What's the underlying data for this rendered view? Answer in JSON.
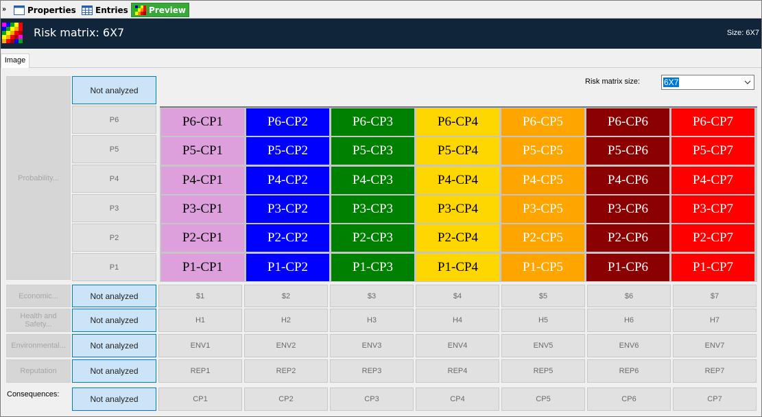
{
  "tabs": {
    "properties": "Properties",
    "entries": "Entries",
    "preview": "Preview"
  },
  "header": {
    "title": "Risk matrix: 6X7",
    "size": "Size: 6X7"
  },
  "subtab": "Image",
  "size_selector": {
    "label": "Risk matrix size:",
    "value": "6X7"
  },
  "not_analyzed": "Not analyzed",
  "probability_label": "Probability...",
  "probability_levels": [
    "P6",
    "P5",
    "P4",
    "P3",
    "P2",
    "P1"
  ],
  "column_colors": [
    "#dea0dd",
    "#0000ff",
    "#008000",
    "#ffd700",
    "#ffa500",
    "#8b0000",
    "#ff0000"
  ],
  "text_colors": [
    "#000000",
    "#ffffff",
    "#ffffff",
    "#000000",
    "#ffffff",
    "#ffffff",
    "#ffffff"
  ],
  "cells": [
    [
      "P6-CP1",
      "P6-CP2",
      "P6-CP3",
      "P6-CP4",
      "P6-CP5",
      "P6-CP6",
      "P6-CP7"
    ],
    [
      "P5-CP1",
      "P5-CP2",
      "P5-CP3",
      "P5-CP4",
      "P5-CP5",
      "P5-CP6",
      "P5-CP7"
    ],
    [
      "P4-CP1",
      "P4-CP2",
      "P4-CP3",
      "P4-CP4",
      "P4-CP5",
      "P4-CP6",
      "P4-CP7"
    ],
    [
      "P3-CP1",
      "P3-CP2",
      "P3-CP3",
      "P3-CP4",
      "P3-CP5",
      "P3-CP6",
      "P3-CP7"
    ],
    [
      "P2-CP1",
      "P2-CP2",
      "P2-CP3",
      "P2-CP4",
      "P2-CP5",
      "P2-CP6",
      "P2-CP7"
    ],
    [
      "P1-CP1",
      "P1-CP2",
      "P1-CP3",
      "P1-CP4",
      "P1-CP5",
      "P1-CP6",
      "P1-CP7"
    ]
  ],
  "consequence_rows": [
    {
      "label": "Economic...",
      "status": "Not analyzed",
      "values": [
        "$1",
        "$2",
        "$3",
        "$4",
        "$5",
        "$6",
        "$7"
      ]
    },
    {
      "label": "Health and Safety...",
      "status": "Not analyzed",
      "values": [
        "H1",
        "H2",
        "H3",
        "H4",
        "H5",
        "H6",
        "H7"
      ]
    },
    {
      "label": "Environmental...",
      "status": "Not analyzed",
      "values": [
        "ENV1",
        "ENV2",
        "ENV3",
        "ENV4",
        "ENV5",
        "ENV6",
        "ENV7"
      ]
    },
    {
      "label": "Reputation",
      "status": "Not analyzed",
      "values": [
        "REP1",
        "REP2",
        "REP3",
        "REP4",
        "REP5",
        "REP6",
        "REP7"
      ]
    }
  ],
  "consequences": {
    "label": "Consequences:",
    "status": "Not analyzed",
    "values": [
      "CP1",
      "CP2",
      "CP3",
      "CP4",
      "CP5",
      "CP6",
      "CP7"
    ]
  }
}
